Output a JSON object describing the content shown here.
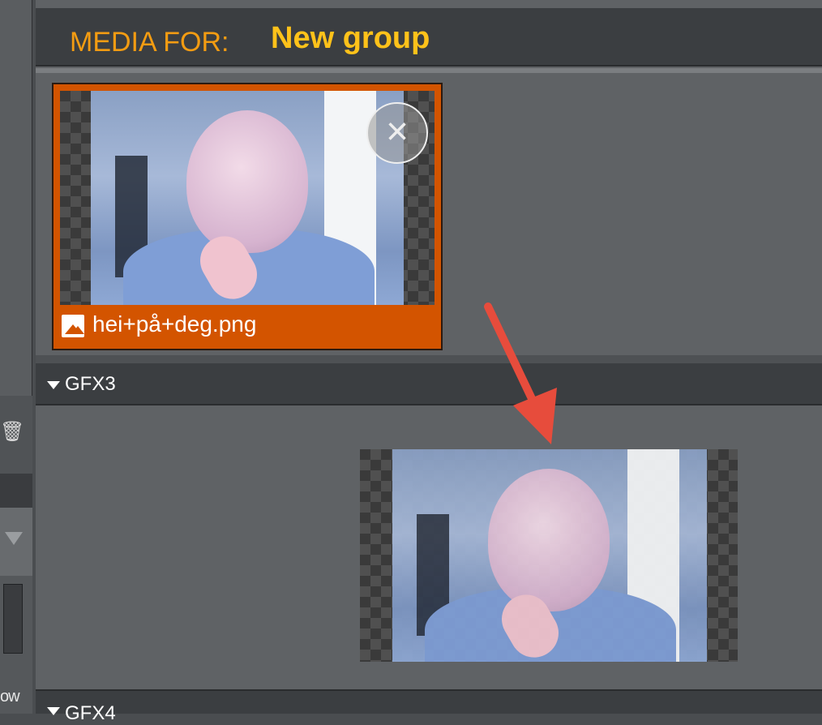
{
  "sidebar": {
    "trash_icon": "trash-icon",
    "bottom_text": "ow"
  },
  "panel": {
    "header_label": "MEDIA FOR:",
    "group_name": "New group",
    "media_item": {
      "filename": "hei+på+deg.png",
      "file_icon": "image-icon",
      "remove_icon": "close-icon",
      "remove_symbol": "×"
    },
    "sections": [
      {
        "name": "GFX3",
        "expanded": true
      },
      {
        "name": "GFX4",
        "expanded": true
      }
    ]
  },
  "colors": {
    "accent_orange": "#d35400",
    "header_label": "#f39c12",
    "group_name": "#ffc21a",
    "arrow": "#e74c3c"
  }
}
